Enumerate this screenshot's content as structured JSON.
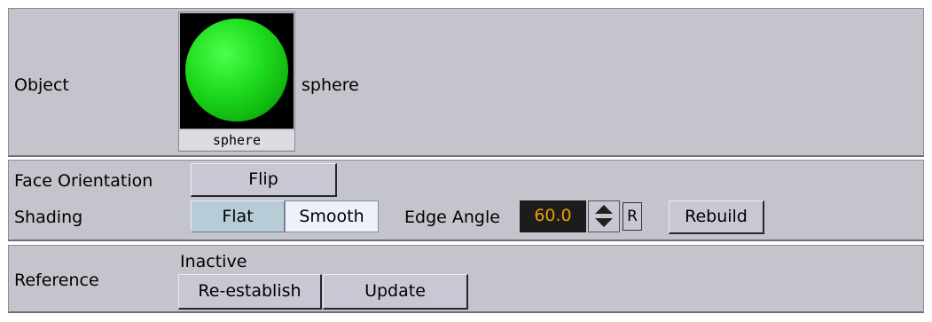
{
  "object": {
    "label": "Object",
    "thumbnail_caption": "sphere",
    "name": "sphere"
  },
  "geometry": {
    "face_orientation_label": "Face Orientation",
    "flip_label": "Flip",
    "shading_label": "Shading",
    "flat_label": "Flat",
    "smooth_label": "Smooth",
    "selected_shading": "Smooth",
    "edge_angle_label": "Edge Angle",
    "edge_angle_value": "60.0",
    "reset_label": "R",
    "rebuild_label": "Rebuild"
  },
  "reference": {
    "label": "Reference",
    "status": "Inactive",
    "reestablish_label": "Re-establish",
    "update_label": "Update"
  },
  "colors": {
    "panel_bg": "#c4c4cc",
    "sphere_green": "#22e022",
    "value_text": "#e8a000",
    "value_bg": "#1c1c1c",
    "selected_toggle": "#eef0fb",
    "flat_toggle": "#b8ccd8"
  },
  "icons": {
    "spin_up": "spin-up-icon",
    "spin_down": "spin-down-icon"
  }
}
